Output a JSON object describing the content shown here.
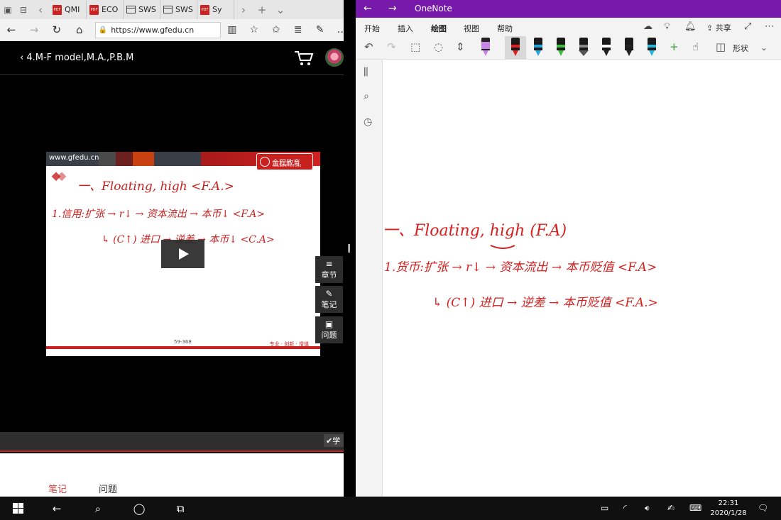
{
  "browser": {
    "tabs": [
      {
        "label": "QMI",
        "icon": "pdf"
      },
      {
        "label": "ECO",
        "icon": "pdf"
      },
      {
        "label": "SWS",
        "icon": "window"
      },
      {
        "label": "SWS",
        "icon": "window"
      },
      {
        "label": "Sy",
        "icon": "pdf"
      }
    ],
    "pdf_badge": "PDF",
    "url": "https://www.gfedu.cn",
    "page_title": "4.M-F model,M.A.,P.B.M",
    "video": {
      "site": "www.gfedu.cn",
      "logo_cn": "金程教育",
      "logo_en": "GOLDEN FUTURE",
      "page": "59-368",
      "slogan": "专业 · 创新 · 增值",
      "writing": {
        "line1": "一、Floating, high <F.A.>",
        "line2": "1.信用:扩张 → r↓ → 资本流出 → 本币↓ <F.A>",
        "line3": "↳ (C↑) 进口 → 逆差 → 本币↓ <C.A>"
      }
    },
    "side_buttons": [
      {
        "label": "章节",
        "icon": "list-icon"
      },
      {
        "label": "笔记",
        "icon": "pencil-icon"
      },
      {
        "label": "问题",
        "icon": "question-icon"
      }
    ],
    "learn_label": "✔学",
    "bottom_tabs": {
      "note": "笔记",
      "question": "问题"
    },
    "accent": "#d44444"
  },
  "onenote": {
    "app_name": "OneNote",
    "tabs": [
      "开始",
      "插入",
      "绘图",
      "视图",
      "帮助"
    ],
    "active_tab": "绘图",
    "share_label": "共享",
    "shape_label": "形状",
    "pens": [
      {
        "band": "#c586e8",
        "tip": "#c586e8",
        "kind": "highlighter"
      },
      {
        "band": "#e02020",
        "tip": "#e02020",
        "kind": "pen",
        "selected": true
      },
      {
        "band": "#22a8e0",
        "tip": "#22a8e0",
        "kind": "pen"
      },
      {
        "band": "#3cbf3c",
        "tip": "#3cbf3c",
        "kind": "pen"
      },
      {
        "band": "#888888",
        "tip": "#555555",
        "kind": "marker"
      },
      {
        "band": "#ffffff",
        "tip": "#222222",
        "kind": "pen"
      },
      {
        "band": "#222222",
        "tip": "#222222",
        "kind": "pen"
      },
      {
        "band": "#22b8e0",
        "tip": "#22b8e0",
        "kind": "pen"
      }
    ],
    "ink_color": "#d61f1f",
    "notes": {
      "line1": "一、Floating, high (F.A)",
      "line2": "1.货币:扩张 → r↓ → 资本流出 → 本币贬值 <F.A>",
      "line3": "↳ (C↑) 进口 → 逆差 → 本币贬值 <F.A.>"
    },
    "brand": "#7719aa"
  },
  "taskbar": {
    "time": "22:31",
    "date": "2020/1/28"
  }
}
